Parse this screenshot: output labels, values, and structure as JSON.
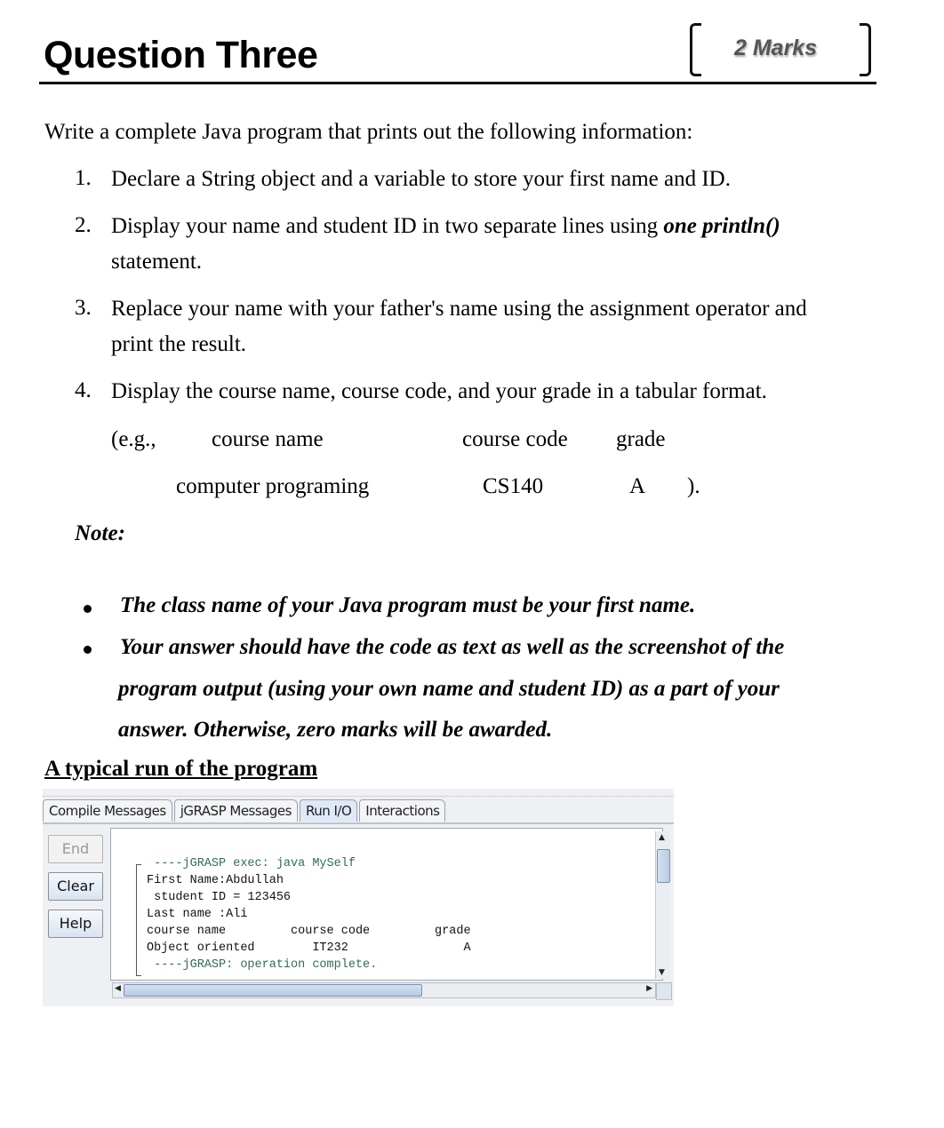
{
  "header": {
    "title": "Question Three",
    "marks": "2 Marks"
  },
  "intro": "Write a complete Java program that prints out the following information:",
  "steps": [
    {
      "num": "1.",
      "lines": [
        "Declare a String object and a variable to store your first name and ID."
      ]
    },
    {
      "num": "2.",
      "line1_prefix": "Display your name and student ID in two separate lines using ",
      "line1_emph": "one println()",
      "line2": "statement."
    },
    {
      "num": "3.",
      "lines": [
        "Replace your name with your father's name using the assignment operator and",
        "print the result."
      ]
    },
    {
      "num": "4.",
      "lines": [
        "Display the course name, course code, and your grade in a tabular format."
      ]
    }
  ],
  "example": {
    "prefix": "(e.g.,",
    "headers": [
      "course name",
      "course code",
      "grade"
    ],
    "row": [
      "computer programing",
      "CS140",
      "A"
    ],
    "suffix": ")."
  },
  "note_label": "Note:",
  "notes": [
    "The class name of your Java program must be your first name.",
    "Your answer should have the code as text as well as the screenshot of the",
    "program output (using your own name and student ID) as a part of your",
    "answer. Otherwise, zero marks will be awarded."
  ],
  "section_heading": "A typical run of the program",
  "jgrasp": {
    "tabs": [
      "Compile Messages",
      "jGRASP Messages",
      "Run I/O",
      "Interactions"
    ],
    "active_tab": "Run I/O",
    "buttons": {
      "end": "End",
      "clear": "Clear",
      "help": "Help"
    },
    "output_lines": [
      " ----jGRASP exec: java MySelf",
      "First Name:Abdullah",
      " student ID = 123456",
      "Last name :Ali",
      "course name         course code         grade",
      "Object oriented        IT232                A",
      " ----jGRASP: operation complete."
    ]
  }
}
